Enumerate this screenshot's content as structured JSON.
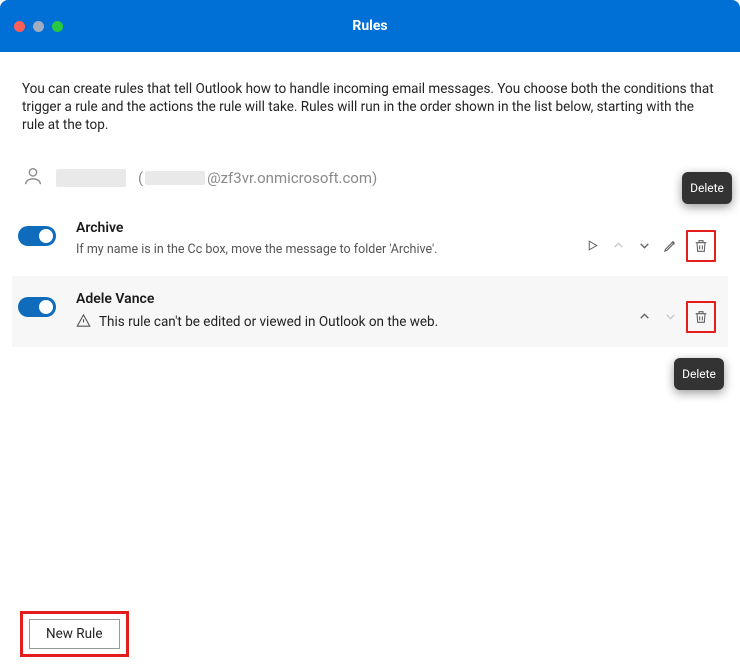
{
  "window": {
    "title": "Rules"
  },
  "description": "You can create rules that tell Outlook how to handle incoming email messages. You choose both the conditions that trigger a rule and the actions the rule will take. Rules will run in the order shown in the list below, starting with the rule at the top.",
  "account": {
    "domain_suffix": "@zf3vr.onmicrosoft.com)",
    "paren_open": "("
  },
  "rules": [
    {
      "name": "Archive",
      "description": "If my name is in the Cc box, move the message to folder 'Archive'.",
      "editable": true
    },
    {
      "name": "Adele Vance",
      "warning": "This rule can't be edited or viewed in Outlook on the web.",
      "editable": false
    }
  ],
  "tooltips": {
    "delete1": "Delete",
    "delete2": "Delete"
  },
  "footer": {
    "new_rule_label": "New Rule"
  }
}
